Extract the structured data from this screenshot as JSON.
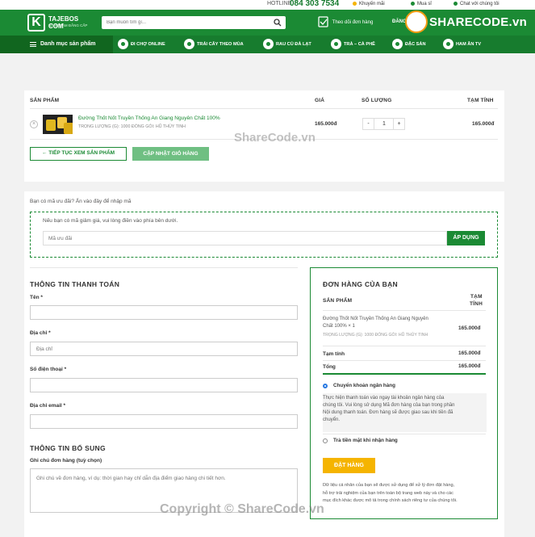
{
  "topbar": {
    "hotline_label": "HOTLINE",
    "hotline_number": "084 303 7534",
    "promo": "Khuyến mãi",
    "buy": "Mua sỉ",
    "chat": "Chat với chúng tôi"
  },
  "header": {
    "logo_name": "TAJEBOS COM",
    "logo_tagline": "NÂNG TẦM ĐẲNG CẤP",
    "search_placeholder": "Bạn muốn tìm gì...",
    "track_order": "Theo dõi đơn hàng",
    "login": "ĐĂNG",
    "sharecode": "SHARECODE.vn"
  },
  "nav": {
    "category": "Danh mục sản phẩm",
    "items": [
      "ĐI CHỢ ONLINE",
      "TRÁI CÂY THEO MÙA",
      "RAU CỦ ĐÀ LẠT",
      "TRÀ – CÀ PHÊ",
      "ĐẶC SẢN",
      "HAM ĂN TV"
    ]
  },
  "cart": {
    "headers": {
      "product": "SẢN PHẨM",
      "price": "GIÁ",
      "qty": "SỐ LƯỢNG",
      "total": "TẠM TÍNH"
    },
    "item": {
      "name": "Đường Thốt Nốt Truyền Thống An Giang Nguyên Chất 100%",
      "meta": "TRỌNG LƯỢNG (G):  1000  ĐÓNG GÓI:  HŨ THỦY TINH",
      "price": "165.000đ",
      "qty": "1",
      "minus": "-",
      "plus": "+",
      "subtotal": "165.000đ",
      "remove": "×"
    },
    "continue_btn": "← TIẾP TỤC XEM SẢN PHẨM",
    "update_btn": "CẬP NHẬT GIỎ HÀNG"
  },
  "coupon": {
    "toggle_text": "Bạn có mã ưu đãi? Ấn vào đây để nhập mã",
    "hint": "Nếu bạn có mã giảm giá, vui lòng điền vào phía bên dưới.",
    "placeholder": "Mã ưu đãi",
    "apply_btn": "ÁP DỤNG"
  },
  "billing": {
    "title": "THÔNG TIN THANH TOÁN",
    "name_label": "Tên *",
    "address_label": "Địa chỉ *",
    "address_placeholder": "Địa chỉ",
    "phone_label": "Số điện thoại *",
    "email_label": "Địa chỉ email *",
    "extra_title": "THÔNG TIN BỔ SUNG",
    "notes_label": "Ghi chú đơn hàng (tuỳ chọn)",
    "notes_placeholder": "Ghi chú về đơn hàng, ví dụ: thời gian hay chỉ dẫn địa điểm giao hàng chi tiết hơn."
  },
  "order": {
    "title": "ĐƠN HÀNG CỦA BẠN",
    "col_product": "SẢN PHẨM",
    "col_total_1": "TẠM",
    "col_total_2": "TÍNH",
    "item_line1": "Đường Thốt Nốt Truyền Thống An Giang Nguyên",
    "item_line2": "Chất 100%  × 1",
    "item_meta": "TRỌNG LƯỢNG (G):  1000  ĐÓNG GÓI:  HŨ THỦY TINH",
    "item_total": "165.000đ",
    "subtotal_label": "Tạm tính",
    "subtotal": "165.000đ",
    "total_label": "Tổng",
    "total": "165.000đ",
    "pay_bank": "Chuyển khoản ngân hàng",
    "pay_bank_desc_1": "Thực hiện thanh toán vào ngay tài khoản ngân hàng của",
    "pay_bank_desc_2": "chúng tôi. Vui lòng sử dụng Mã đơn hàng của bạn trong phần",
    "pay_bank_desc_3": "Nội dung thanh toán. Đơn hàng sẽ được giao sau khi tiền đã",
    "pay_bank_desc_4": "chuyển.",
    "pay_cod": "Trả tiền mặt khi nhận hàng",
    "place_btn": "ĐẶT HÀNG",
    "privacy_1": "Dữ liệu cá nhân của bạn sẽ được sử dụng để xử lý đơn đặt hàng,",
    "privacy_2": "hỗ trợ trải nghiệm của bạn trên toàn bộ trang web này và cho các",
    "privacy_3": "mục đích khác được mô tả trong chính sách riêng tư của chúng tôi."
  },
  "watermarks": {
    "middle": "ShareCode.vn",
    "bottom": "Copyright © ShareCode.vn"
  },
  "colors": {
    "brand": "#1b8a34",
    "accent": "#f5b400"
  }
}
